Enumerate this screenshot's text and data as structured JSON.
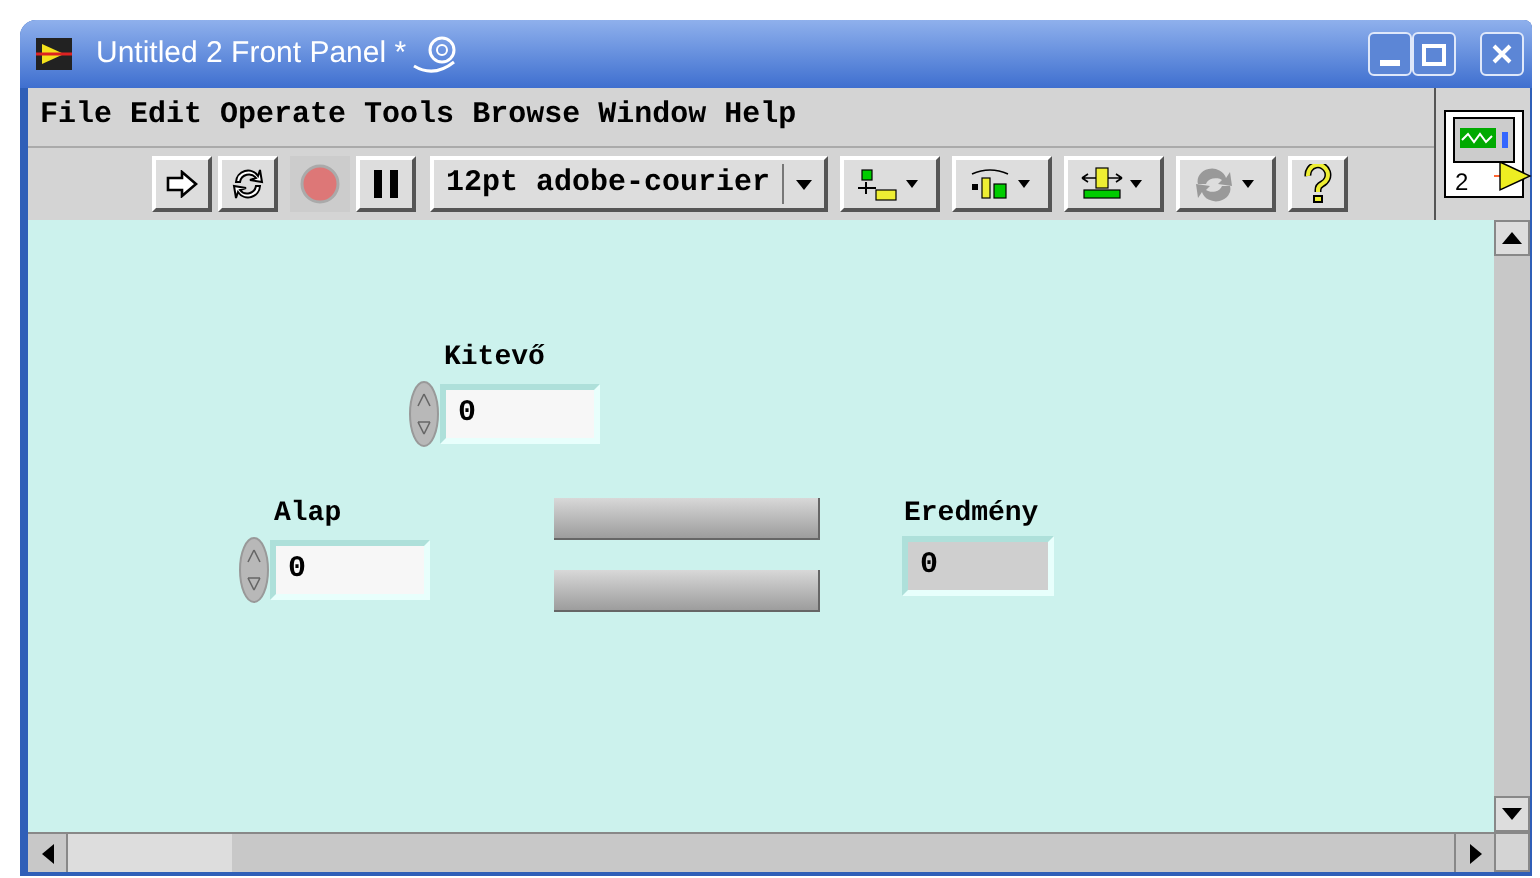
{
  "window": {
    "title": "Untitled 2 Front Panel *"
  },
  "menu": [
    "File",
    "Edit",
    "Operate",
    "Tools",
    "Browse",
    "Window",
    "Help"
  ],
  "toolbar": {
    "font": "12pt adobe-courier"
  },
  "connector_pane": {
    "label": "2"
  },
  "panel": {
    "objects": [
      {
        "kind": "control",
        "label": "Kitevő",
        "value": "0"
      },
      {
        "kind": "control",
        "label": "Alap",
        "value": "0"
      },
      {
        "kind": "bar"
      },
      {
        "kind": "bar"
      },
      {
        "kind": "indicator",
        "label": "Eredmény",
        "value": "0"
      }
    ]
  }
}
